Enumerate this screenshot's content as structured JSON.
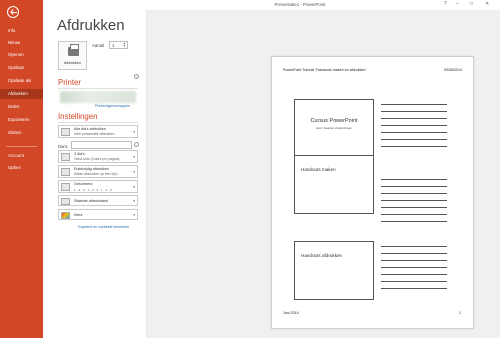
{
  "window": {
    "title": "Presentatie1 - PowerPoint"
  },
  "sidebar": {
    "items": [
      {
        "label": "Info"
      },
      {
        "label": "Nieuw"
      },
      {
        "label": "Openen"
      },
      {
        "label": "Opslaan"
      },
      {
        "label": "Opslaan als"
      },
      {
        "label": "Afdrukken",
        "active": true
      },
      {
        "label": "Delen"
      },
      {
        "label": "Exporteren"
      },
      {
        "label": "Sluiten"
      },
      {
        "label": "Account"
      },
      {
        "label": "Opties"
      }
    ]
  },
  "page": {
    "title": "Afdrukken"
  },
  "print": {
    "button_label": "Afdrukken",
    "copies_label": "Aantal",
    "copies_value": "1"
  },
  "printer": {
    "section": "Printer",
    "properties_link": "Printereigenschappen"
  },
  "settings": {
    "section": "Instellingen",
    "slides_label": "Dia's:",
    "items": [
      {
        "line1": "Alle dia's afdrukken",
        "line2": "Hele presentatie afdrukken"
      },
      {
        "line1": "3 dia's",
        "line2": "Hand-outs (3 dia's per pagina)"
      },
      {
        "line1": "Enkelzijdig afdrukken",
        "line2": "Alleen afdrukken op één zijd..."
      },
      {
        "line1": "Gesorteerd",
        "line2": "1,2,3    1,2,3    1,2,3"
      },
      {
        "line1": "Staande afdrukstand",
        "line2": ""
      },
      {
        "line1": "Kleur",
        "line2": ""
      }
    ],
    "header_footer_link": "Koptekst en voettekst bewerken"
  },
  "preview": {
    "header": "PowerPoint Tutorial \"Handouts maken en afdrukken\"",
    "date": "03/06/2014",
    "slides": [
      {
        "title": "Cursus PowerPoint",
        "subtitle": "door: Gaarde Vanderlingen"
      },
      {
        "title": "Handouts maken",
        "subtitle": ""
      },
      {
        "title": "Handouts afdrukken",
        "subtitle": ""
      }
    ],
    "footer_left": "Juni 2014",
    "page_number": "1"
  },
  "colors": {
    "accent": "#d24726",
    "active_nav": "#a5361a",
    "link": "#2b6cb0"
  }
}
